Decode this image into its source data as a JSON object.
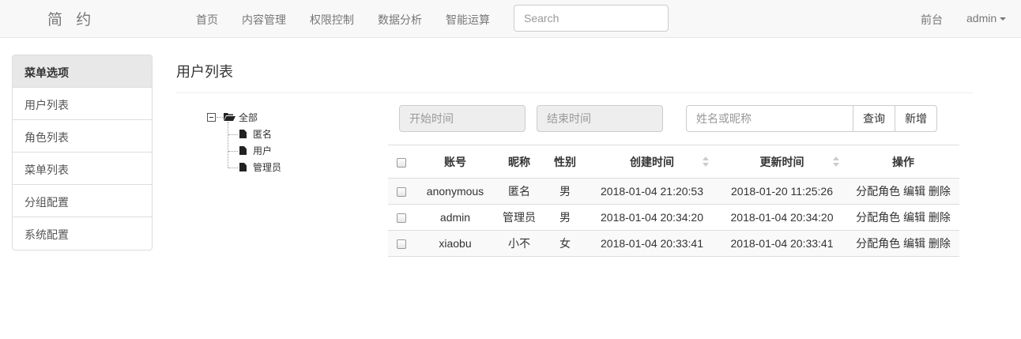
{
  "brand": "简 约",
  "nav": {
    "items": [
      "首页",
      "内容管理",
      "权限控制",
      "数据分析",
      "智能运算"
    ],
    "search_placeholder": "Search",
    "frontend_label": "前台",
    "user_label": "admin"
  },
  "sidebar": {
    "heading": "菜单选项",
    "items": [
      "用户列表",
      "角色列表",
      "菜单列表",
      "分组配置",
      "系统配置"
    ]
  },
  "main": {
    "title": "用户列表"
  },
  "tree": {
    "root": "全部",
    "children": [
      "匿名",
      "用户",
      "管理员"
    ]
  },
  "filters": {
    "start_placeholder": "开始时间",
    "end_placeholder": "结束时间",
    "name_placeholder": "姓名或昵称",
    "query_label": "查询",
    "add_label": "新增"
  },
  "table": {
    "headers": [
      "账号",
      "昵称",
      "性别",
      "创建时间",
      "更新时间",
      "操作"
    ],
    "rows": [
      {
        "account": "anonymous",
        "nickname": "匿名",
        "gender": "男",
        "created": "2018-01-04 21:20:53",
        "updated": "2018-01-20 11:25:26"
      },
      {
        "account": "admin",
        "nickname": "管理员",
        "gender": "男",
        "created": "2018-01-04 20:34:20",
        "updated": "2018-01-04 20:34:20"
      },
      {
        "account": "xiaobu",
        "nickname": "小不",
        "gender": "女",
        "created": "2018-01-04 20:33:41",
        "updated": "2018-01-04 20:33:41"
      }
    ],
    "actions": {
      "assign": "分配角色",
      "edit": "编辑",
      "delete": "删除"
    }
  },
  "colors": {
    "navbar_bg": "#f8f8f8",
    "sidebar_heading_bg": "#e8e8e8",
    "stripe_bg": "#f9f9f9",
    "disabled_input_bg": "#eeeeee"
  }
}
